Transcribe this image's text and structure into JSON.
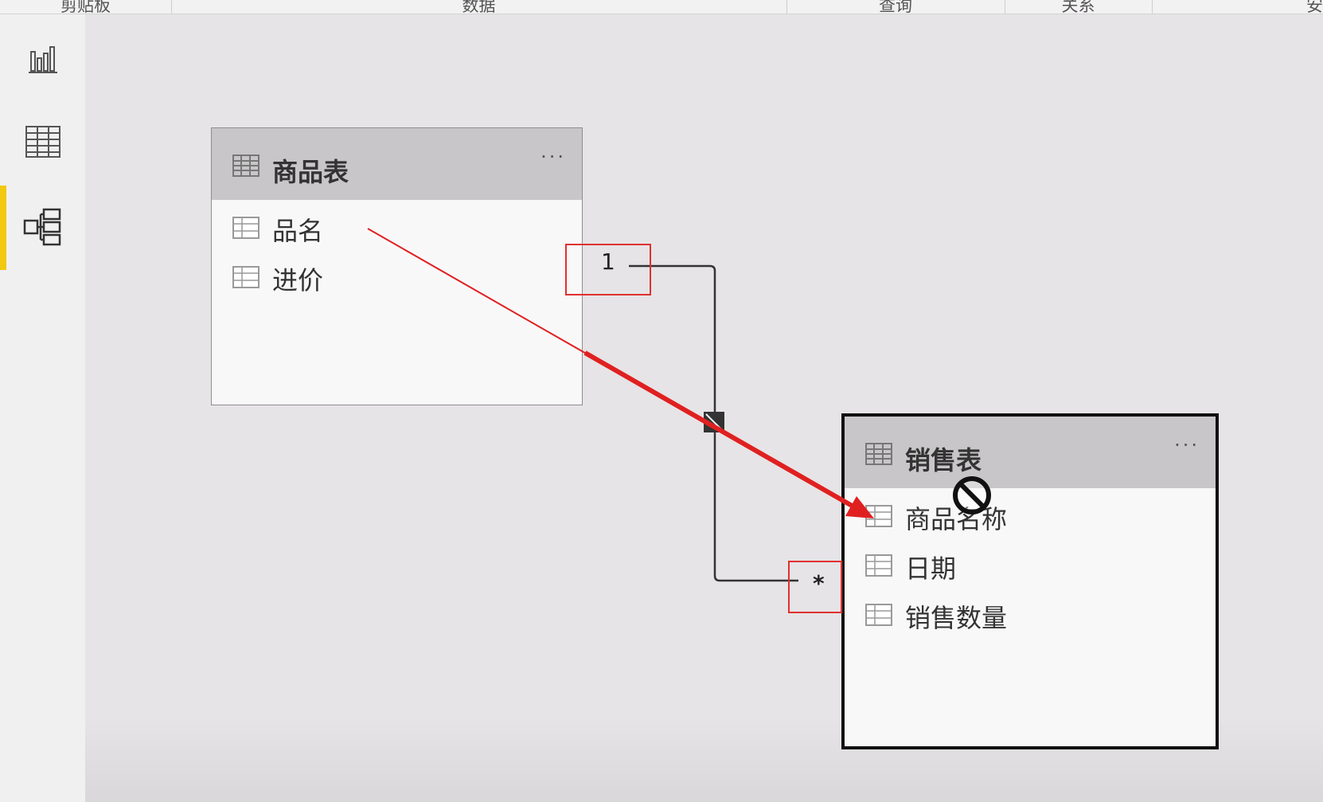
{
  "ribbon": {
    "groups": [
      "剪贴板",
      "数据",
      "查询",
      "关系",
      "安"
    ]
  },
  "nav": {
    "items": [
      {
        "name": "report-view",
        "icon": "bar-chart-icon"
      },
      {
        "name": "data-view",
        "icon": "table-grid-icon"
      },
      {
        "name": "model-view",
        "icon": "relationship-icon",
        "active": true
      }
    ],
    "active_color": "#f2c811"
  },
  "tables": [
    {
      "title": "商品表",
      "more": "···",
      "fields": [
        "品名",
        "进价"
      ]
    },
    {
      "title": "销售表",
      "more": "···",
      "fields": [
        "商品名称",
        "日期",
        "销售数量"
      ]
    }
  ],
  "relationship": {
    "one_side": "1",
    "many_side": "*"
  },
  "annotation": {
    "arrow_color": "#e02020",
    "highlight_color": "#e03030"
  }
}
